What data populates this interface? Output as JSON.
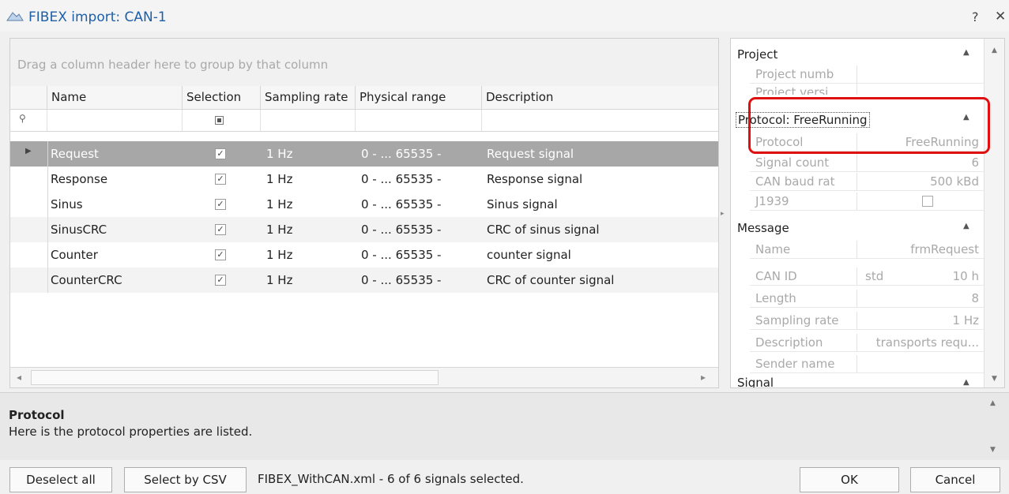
{
  "window": {
    "title": "FIBEX import: CAN-1",
    "help": "?",
    "close": "✕"
  },
  "grid": {
    "group_hint": "Drag a column header here to group by that column",
    "columns": [
      "Name",
      "Selection",
      "Sampling rate",
      "Physical range",
      "Description"
    ],
    "rows": [
      {
        "name": "Request",
        "selected": true,
        "rate": "1 Hz",
        "range": "0 - ... 65535 -",
        "description": "Request signal"
      },
      {
        "name": "Response",
        "selected": true,
        "rate": "1 Hz",
        "range": "0 - ... 65535 -",
        "description": "Response signal"
      },
      {
        "name": "Sinus",
        "selected": true,
        "rate": "1 Hz",
        "range": "0 - ... 65535 -",
        "description": "Sinus signal"
      },
      {
        "name": "SinusCRC",
        "selected": true,
        "rate": "1 Hz",
        "range": "0 - ... 65535 -",
        "description": "CRC of sinus signal"
      },
      {
        "name": "Counter",
        "selected": true,
        "rate": "1 Hz",
        "range": "0 - ... 65535 -",
        "description": "counter signal"
      },
      {
        "name": "CounterCRC",
        "selected": true,
        "rate": "1 Hz",
        "range": "0 - ... 65535 -",
        "description": "CRC of counter signal"
      }
    ]
  },
  "properties": {
    "project": {
      "label": "Project",
      "rows": [
        {
          "key": "Project numb",
          "value": ""
        },
        {
          "key": "Project versi",
          "value": ""
        }
      ]
    },
    "protocol": {
      "label": "Protocol: FreeRunning",
      "rows": [
        {
          "key": "Protocol",
          "value": "FreeRunning"
        },
        {
          "key": "Signal count",
          "value": "6"
        },
        {
          "key": "CAN baud rat",
          "value": "500 kBd"
        },
        {
          "key": "J1939",
          "value": ""
        }
      ]
    },
    "message": {
      "label": "Message",
      "rows": [
        {
          "key": "Name",
          "value": "frmRequest"
        },
        {
          "key": "CAN ID",
          "value_left": "std",
          "value": "10 h"
        },
        {
          "key": "Length",
          "value": "8"
        },
        {
          "key": "Sampling rate",
          "value": "1 Hz"
        },
        {
          "key": "Description",
          "value": "transports requ..."
        },
        {
          "key": "Sender name",
          "value": ""
        }
      ]
    },
    "signal": {
      "label": "Signal"
    }
  },
  "description_panel": {
    "title": "Protocol",
    "text": "Here is the protocol properties are listed."
  },
  "footer": {
    "deselect_all": "Deselect all",
    "select_by_csv": "Select by CSV",
    "status": "FIBEX_WithCAN.xml  - 6 of 6 signals selected.",
    "ok": "OK",
    "cancel": "Cancel"
  },
  "colors": {
    "selected_row": "#a7a7a7",
    "title": "#1e5fa8",
    "highlight": "#e01010"
  }
}
